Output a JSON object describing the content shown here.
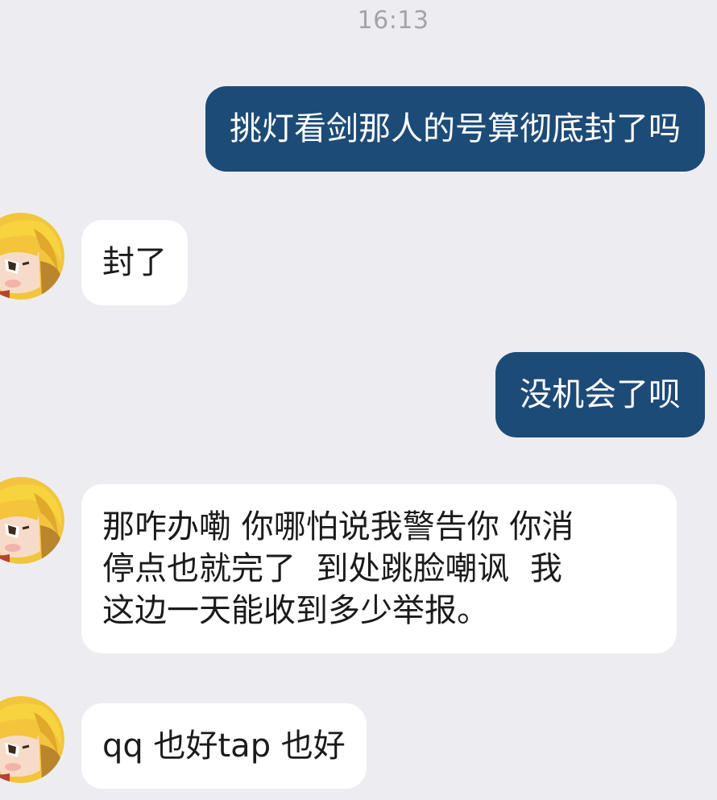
{
  "chat": {
    "timestamp": "16:13",
    "messages": [
      {
        "side": "out",
        "text": "挑灯看剑那人的号算彻底封了吗"
      },
      {
        "side": "in",
        "text": "封了"
      },
      {
        "side": "out",
        "text": "没机会了呗"
      },
      {
        "side": "in",
        "text": "那咋办嘞 你哪怕说我警告你 你消\n停点也就完了  到处跳脸嘲讽  我\n这边一天能收到多少举报。"
      },
      {
        "side": "in",
        "text": "qq 也好tap 也好"
      }
    ]
  },
  "colors": {
    "background": "#ededf1",
    "outgoing_bubble": "#1d4b77",
    "incoming_bubble": "#ffffff"
  },
  "icons": {
    "avatar": "cartoon-blond-character-avatar"
  }
}
